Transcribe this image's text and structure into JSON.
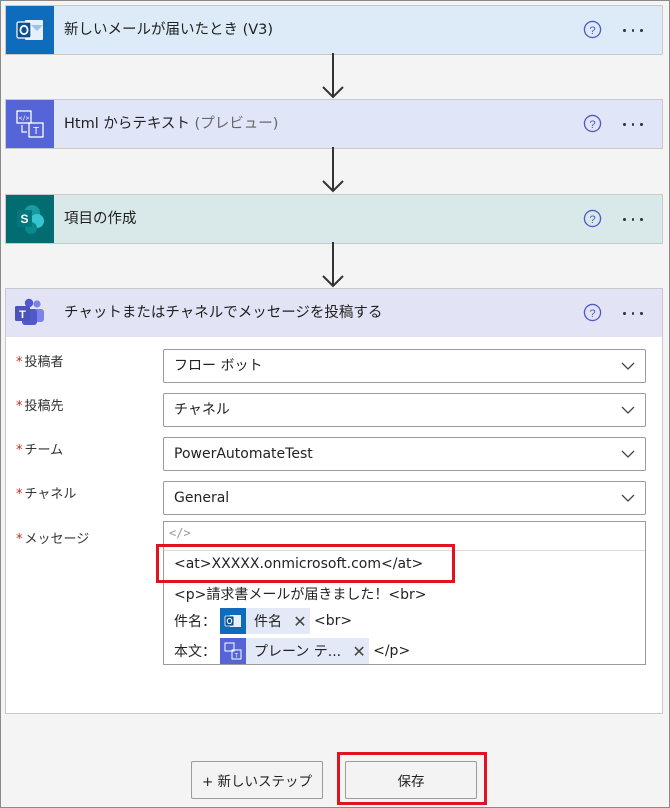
{
  "cards": [
    {
      "title": "新しいメールが届いたとき (V3)",
      "title_muted": "",
      "icon": "outlook-icon",
      "bg": "#dcebf7"
    },
    {
      "title": "Html からテキスト",
      "title_muted": "(プレビュー)",
      "icon": "html-to-text-icon",
      "bg": "#e1e5f8"
    },
    {
      "title": "項目の作成",
      "title_muted": "",
      "icon": "sharepoint-icon",
      "bg": "#d9e9e9"
    },
    {
      "title": "チャットまたはチャネルでメッセージを投稿する",
      "title_muted": "",
      "icon": "teams-icon",
      "bg": "#e2e4f5"
    }
  ],
  "form": {
    "fields": [
      {
        "label": "投稿者",
        "value": "フロー ボット"
      },
      {
        "label": "投稿先",
        "value": "チャネル"
      },
      {
        "label": "チーム",
        "value": "PowerAutomateTest"
      },
      {
        "label": "チャネル",
        "value": "General"
      }
    ],
    "message_label": "メッセージ",
    "required_mark": "*",
    "code_toggle": "</>",
    "message": {
      "line1": "<at>XXXXX.onmicrosoft.com</at>",
      "line2": "<p>請求書メールが届きました！<br>",
      "line3_prefix": "件名：",
      "line3_token": "件名",
      "line3_suffix": "<br>",
      "line4_prefix": "本文：",
      "line4_token": "プレーン テ...",
      "line4_suffix": "</p>",
      "token_close": "✕"
    }
  },
  "buttons": {
    "new_step": "+ 新しいステップ",
    "save": "保存"
  },
  "colors": {
    "outlook": "#0f6cbd",
    "html_to_text": "#5564d6",
    "sharepoint": "#036c70",
    "teams": "#5059c9",
    "highlight": "#e0141e",
    "help": "#5059c9"
  }
}
